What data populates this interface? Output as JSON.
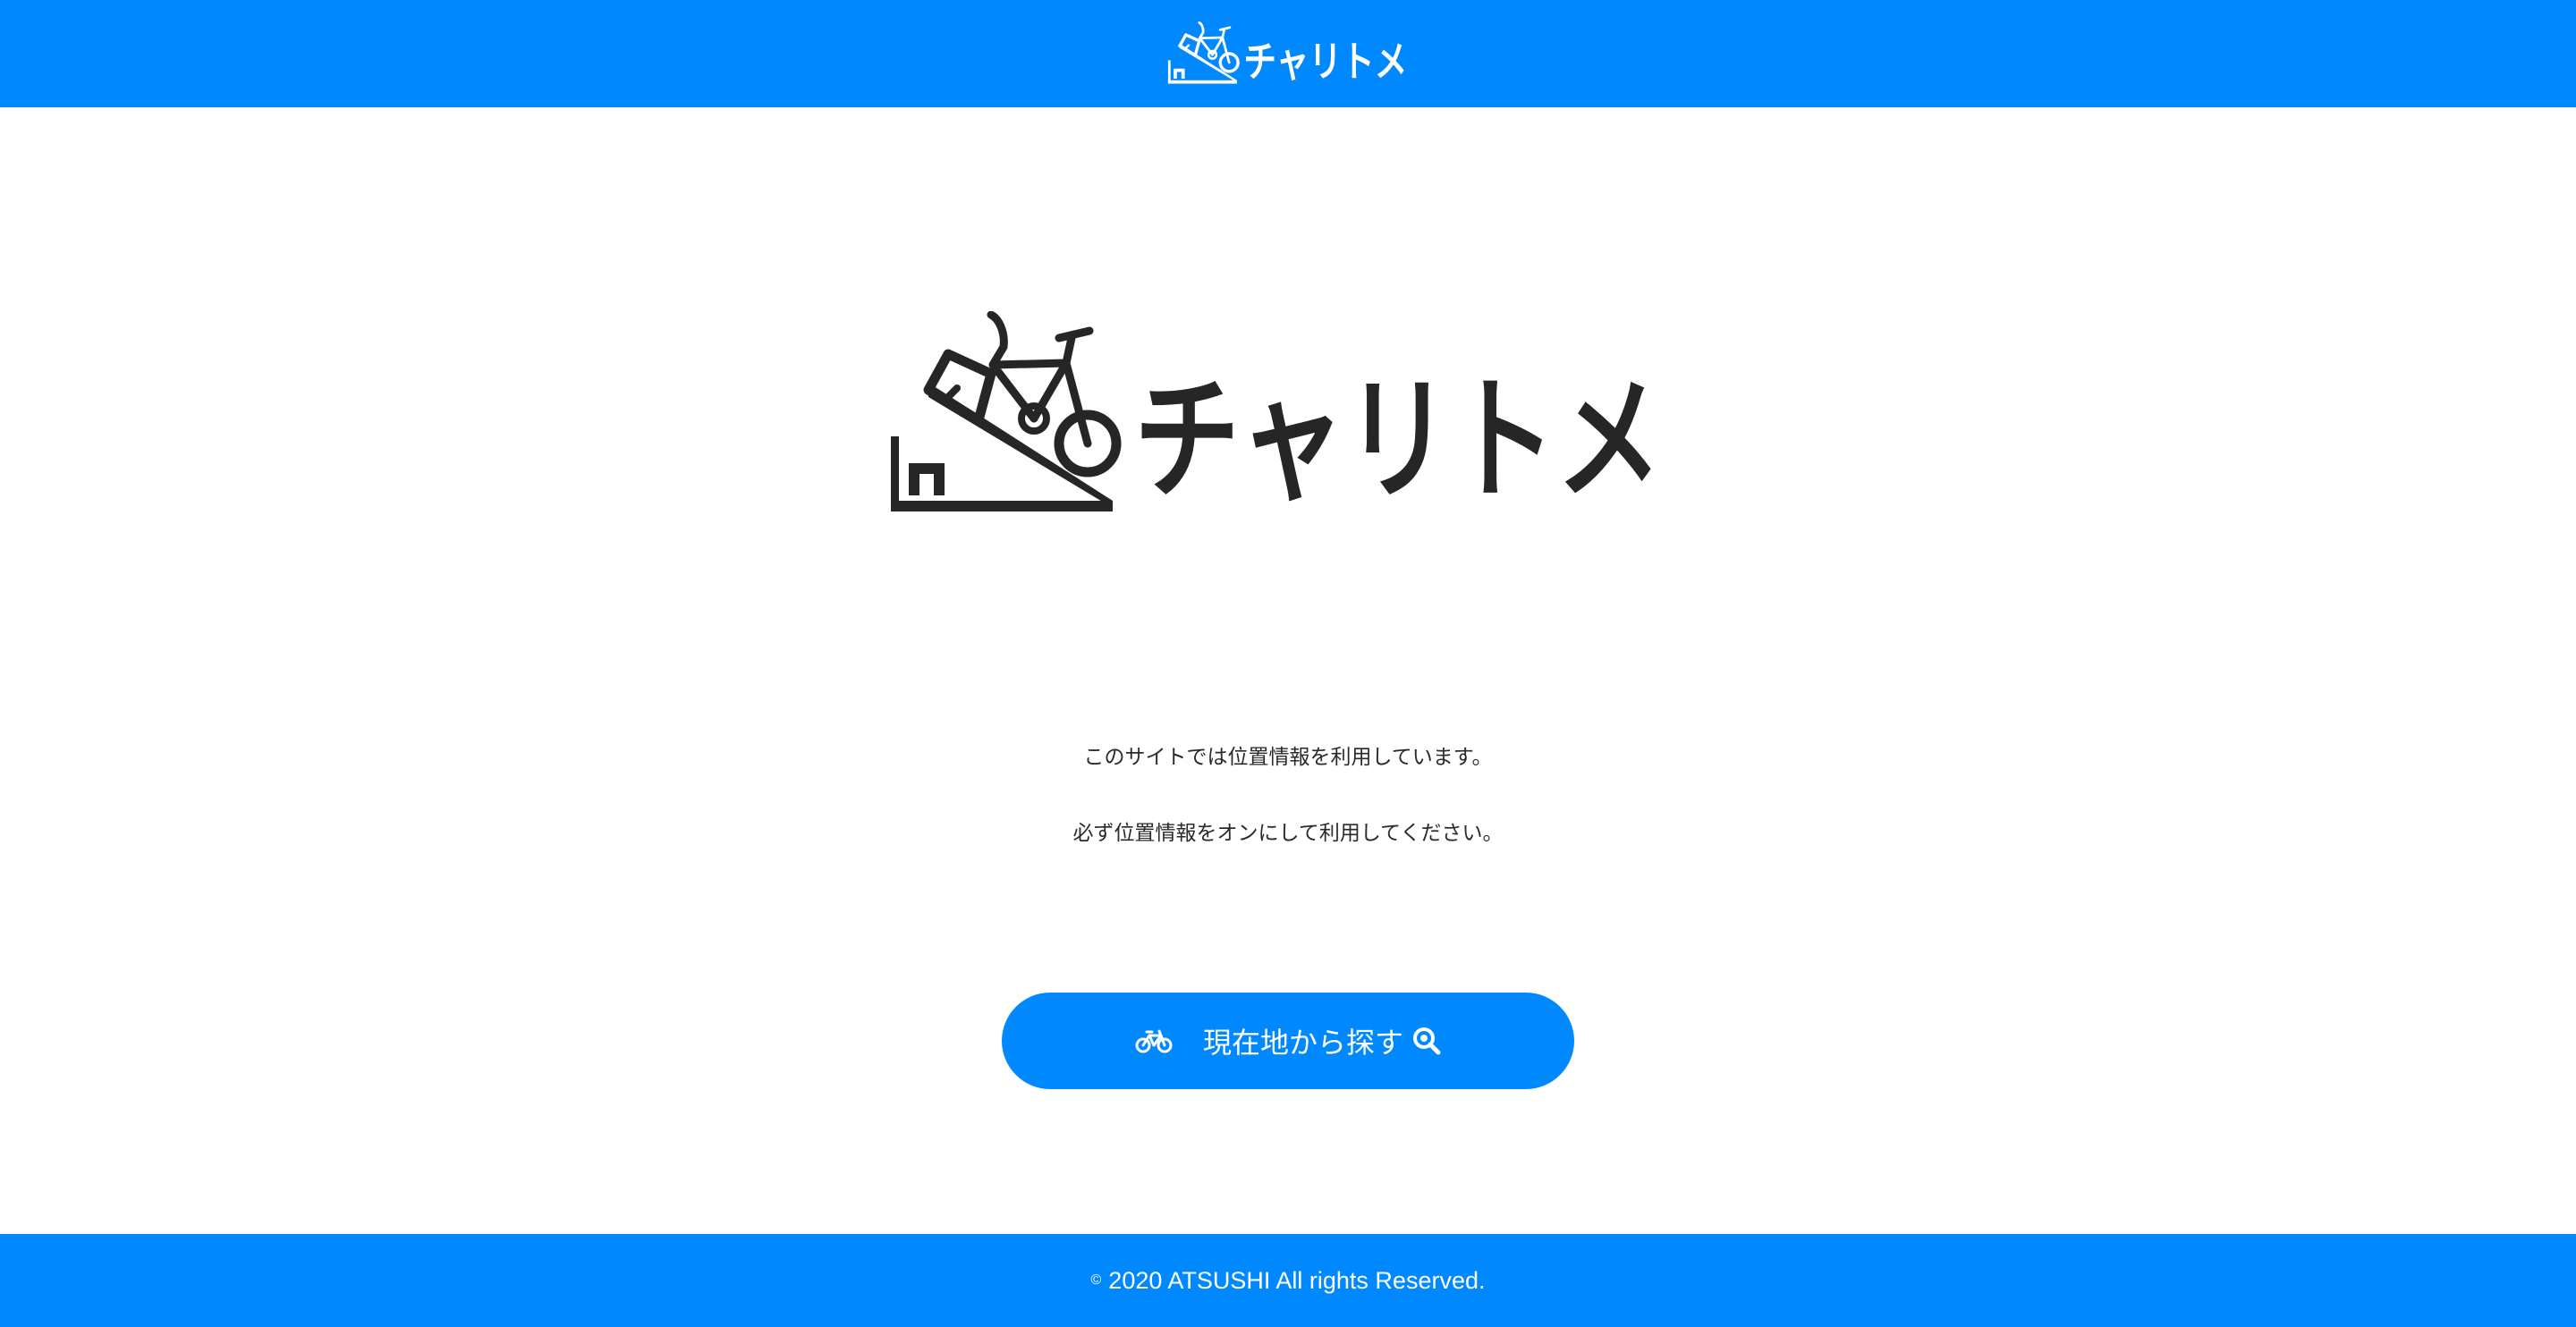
{
  "header": {
    "logo_text": "チャリトメ"
  },
  "hero": {
    "logo_text": "チャリトメ"
  },
  "notice": {
    "line1": "このサイトでは位置情報を利用しています。",
    "line2": "必ず位置情報をオンにして利用してください。"
  },
  "cta": {
    "label": "現在地から探す",
    "icons": [
      "bicycle-icon",
      "magnifier-icon"
    ]
  },
  "footer": {
    "copyright_symbol": "©",
    "text": "2020 ATSUSHI All rights Reserved."
  },
  "colors": {
    "brand_blue": "#0089ff",
    "text_dark": "#2a2a2a",
    "background": "#ffffff"
  }
}
